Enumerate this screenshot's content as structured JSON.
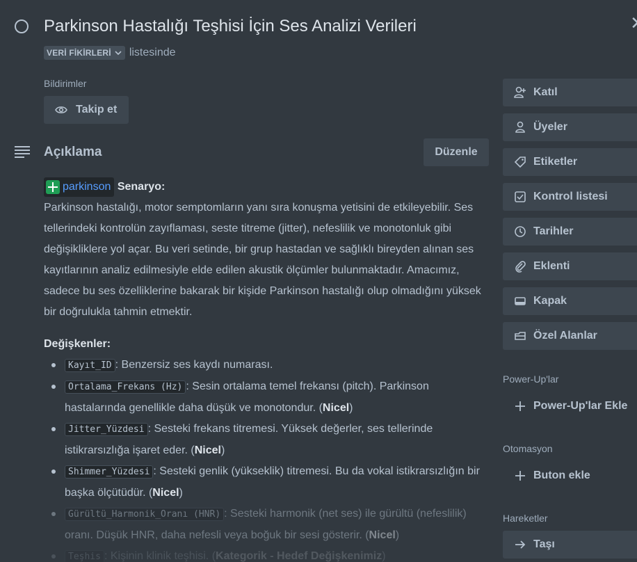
{
  "card": {
    "title": "Parkinson Hastalığı Teşhisi İçin Ses Analizi Verileri",
    "list_name": "VERİ FİKİRLERİ",
    "list_suffix": "listesinde"
  },
  "notifications": {
    "label": "Bildirimler",
    "follow_label": "Takip et"
  },
  "description": {
    "title": "Açıklama",
    "edit_label": "Düzenle",
    "attachment_name": "parkinson",
    "scenario_label": "Senaryo:",
    "paragraph": "Parkinson hastalığı, motor semptomların yanı sıra konuşma yetisini de etkileyebilir. Ses tellerindeki kontrolün zayıflaması, seste titreme (jitter), nefeslilik ve monotonluk gibi değişikliklere yol açar. Bu veri setinde, bir grup hastadan ve sağlıklı bireyden alınan ses kayıtlarının analiz edilmesiyle elde edilen akustik ölçümler bulunmaktadır. Amacımız, sadece bu ses özelliklerine bakarak bir kişide Parkinson hastalığı olup olmadığını yüksek bir doğrulukla tahmin etmektir.",
    "variables_title": "Değişkenler:",
    "variables": [
      {
        "code": "Kayıt_ID",
        "text": ": Benzersiz ses kaydı numarası.",
        "type": ""
      },
      {
        "code": "Ortalama_Frekans (Hz)",
        "text": ": Sesin ortalama temel frekansı (pitch). Parkinson hastalarında genellikle daha düşük ve monotondur. (",
        "type": "Nicel"
      },
      {
        "code": "Jitter_Yüzdesi",
        "text": ": Sesteki frekans titremesi. Yüksek değerler, ses tellerinde istikrarsızlığa işaret eder. (",
        "type": "Nicel"
      },
      {
        "code": "Shimmer_Yüzdesi",
        "text": ": Sesteki genlik (yükseklik) titremesi. Bu da vokal istikrarsızlığın bir başka ölçütüdür. (",
        "type": "Nicel"
      },
      {
        "code": "Gürültü_Harmonik_Oranı (HNR)",
        "text": ": Sesteki harmonik (net ses) ile gürültü (nefeslilik) oranı. Düşük HNR, daha nefesli veya boğuk bir sesi gösterir. (",
        "type": "Nicel"
      },
      {
        "code": "Teşhis",
        "text": ": Kişinin klinik teşhisi. (",
        "type": "Kategorik - Hedef Değişkenimiz"
      }
    ]
  },
  "sidebar": {
    "buttons": [
      {
        "label": "Katıl",
        "icon": "person-add-icon"
      },
      {
        "label": "Üyeler",
        "icon": "person-icon"
      },
      {
        "label": "Etiketler",
        "icon": "tag-icon"
      },
      {
        "label": "Kontrol listesi",
        "icon": "checkbox-icon"
      },
      {
        "label": "Tarihler",
        "icon": "clock-icon"
      },
      {
        "label": "Eklenti",
        "icon": "paperclip-icon"
      },
      {
        "label": "Kapak",
        "icon": "cover-icon"
      },
      {
        "label": "Özel Alanlar",
        "icon": "custom-fields-icon"
      }
    ],
    "powerups_label": "Power-Up'lar",
    "add_powerups_label": "Power-Up'lar Ekle",
    "automation_label": "Otomasyon",
    "add_button_label": "Buton ekle",
    "actions_label": "Hareketler",
    "move_label": "Taşı"
  }
}
